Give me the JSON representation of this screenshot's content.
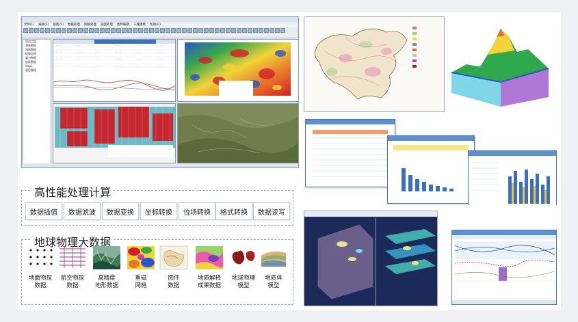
{
  "app_window": {
    "title": "",
    "menu": [
      "文件(F)",
      "编辑(E)",
      "视图(V)",
      "数据处理",
      "网格处理",
      "剖面处理",
      "图件编辑",
      "三维建模",
      "帮助(H)"
    ],
    "tree_items": [
      "项目工程",
      "测线数据",
      "网格数据",
      "航磁异常",
      "重力数据",
      "剖面数据",
      "Map1",
      "图层管理"
    ],
    "status_text": ""
  },
  "section_processing": {
    "title": "高性能处理计算",
    "buttons": [
      "数据插值",
      "数据滤波",
      "数据变换",
      "坐标转换",
      "位场转换",
      "格式转换",
      "数据读写"
    ]
  },
  "section_bigdata": {
    "title": "地球物理大数据",
    "items": [
      {
        "icon": "point-data-icon",
        "label": "地面物探\n数据"
      },
      {
        "icon": "survey-lines-icon",
        "label": "航空物探\n数据"
      },
      {
        "icon": "terrain-icon",
        "label": "高精度\n地形数据"
      },
      {
        "icon": "grid-map-icon",
        "label": "重磁\n网格"
      },
      {
        "icon": "map-sheet-icon",
        "label": "图件\n数据"
      },
      {
        "icon": "geology-map-icon",
        "label": "地质解释\n成果数据"
      },
      {
        "icon": "geophysical-model-icon",
        "label": "地球物理\n模型"
      },
      {
        "icon": "geologic-body-icon",
        "label": "地质体\n模型"
      }
    ]
  },
  "colors": {
    "accent_blue": "#4d78b0",
    "heat_red": "#d0202a",
    "heat_yellow": "#f2d33a",
    "heat_green": "#3aa64a",
    "heat_blue": "#2a56c8"
  }
}
